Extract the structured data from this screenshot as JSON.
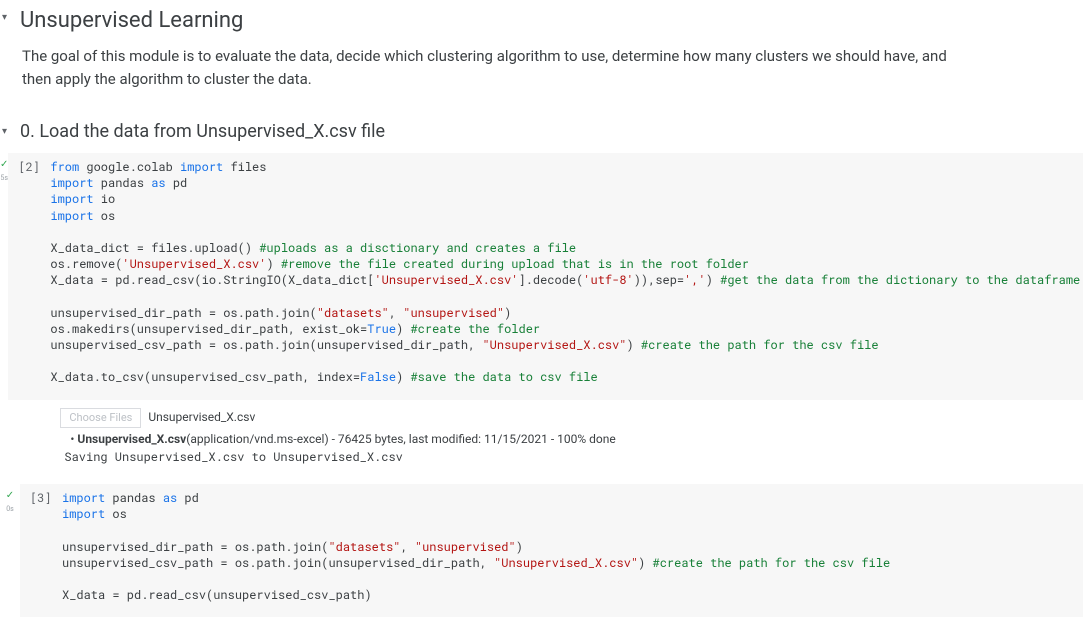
{
  "sections": {
    "unsupervised": {
      "title": "Unsupervised Learning",
      "body": "The goal of this module is to evaluate the data, decide which clustering algorithm to use, determine how many clusters we should have, and then apply the algorithm to cluster the data."
    },
    "load": {
      "title": "0. Load the data from Unsupervised_X.csv file"
    }
  },
  "cells": {
    "c2": {
      "exec_count": "[2]",
      "status_sub": "5s",
      "code_html": "<span class=\"kw\">from</span> google.colab <span class=\"kw\">import</span> files\n<span class=\"kw\">import</span> pandas <span class=\"kw\">as</span> pd\n<span class=\"kw\">import</span> io\n<span class=\"kw\">import</span> os\n\nX_data_dict = files.upload() <span class=\"comment\">#uploads as a disctionary and creates a file</span>\nos.remove(<span class=\"str\">'Unsupervised_X.csv'</span>) <span class=\"comment\">#remove the file created during upload that is in the root folder</span>\nX_data = pd.read_csv(io.StringIO(X_data_dict[<span class=\"str\">'Unsupervised_X.csv'</span>].decode(<span class=\"str\">'utf-8'</span>)),sep=<span class=\"str\">','</span>) <span class=\"comment\">#get the data from the dictionary to the dataframe</span>\n\nunsupervised_dir_path = os.path.join(<span class=\"str\">\"datasets\"</span>, <span class=\"str\">\"unsupervised\"</span>)\nos.makedirs(unsupervised_dir_path, exist_ok=<span class=\"bool\">True</span>) <span class=\"comment\">#create the folder</span>\nunsupervised_csv_path = os.path.join(unsupervised_dir_path, <span class=\"str\">\"Unsupervised_X.csv\"</span>) <span class=\"comment\">#create the path for the csv file</span>\n\nX_data.to_csv(unsupervised_csv_path, index=<span class=\"bool\">False</span>) <span class=\"comment\">#save the data to csv file</span>",
      "output": {
        "choose_files_label": "Choose Files",
        "file_name": "Unsupervised_X.csv",
        "bullet_html": "<b>Unsupervised_X.csv</b>(application/vnd.ms-excel) - 76425 bytes, last modified: 11/15/2021 - 100% done",
        "saving_line": "Saving Unsupervised_X.csv to Unsupervised_X.csv"
      }
    },
    "c3": {
      "exec_count": "[3]",
      "status_sub": "0s",
      "code_html": "<span class=\"kw\">import</span> pandas <span class=\"kw\">as</span> pd\n<span class=\"kw\">import</span> os\n\nunsupervised_dir_path = os.path.join(<span class=\"str\">\"datasets\"</span>, <span class=\"str\">\"unsupervised\"</span>)\nunsupervised_csv_path = os.path.join(unsupervised_dir_path, <span class=\"str\">\"Unsupervised_X.csv\"</span>) <span class=\"comment\">#create the path for the csv file</span>\n\nX_data = pd.read_csv(unsupervised_csv_path)"
    }
  }
}
